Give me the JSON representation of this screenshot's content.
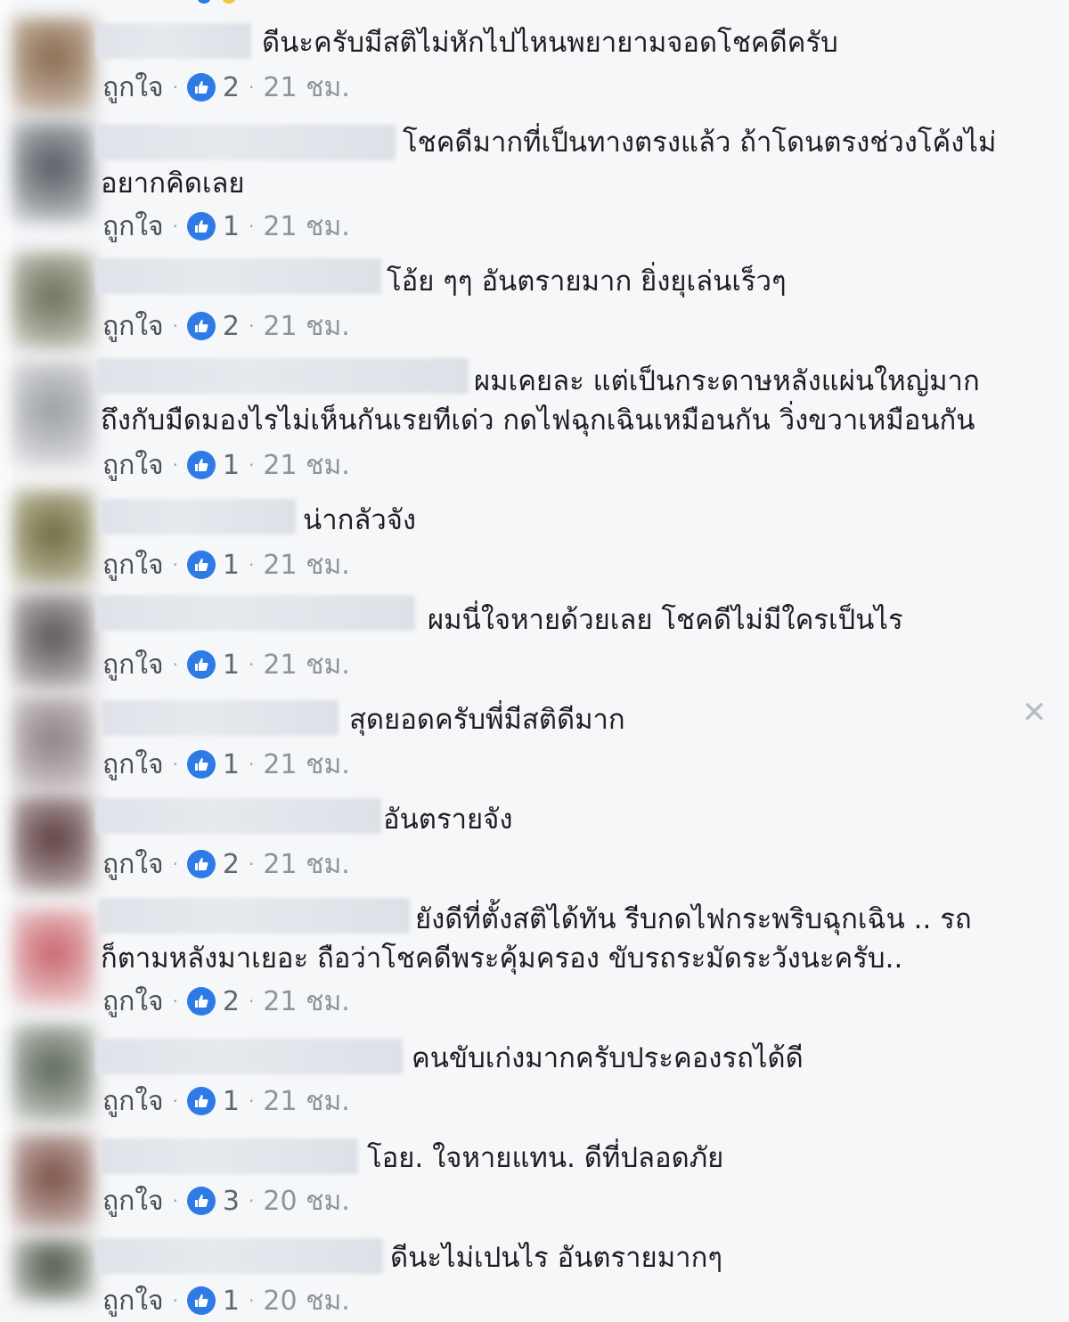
{
  "like_label": "ถูกใจ",
  "time_unit": "ชม.",
  "close_icon": "close-icon",
  "accent_color": "#2f7be6",
  "comments": [
    {
      "text": "ดีนะครับมีสติไม่หักไปไหนพยายามจอดโชคดีครับ",
      "text2": "",
      "likes": "2",
      "time": "21"
    },
    {
      "text": "โชคดีมากที่เป็นทางตรงแล้ว ถ้าโดนตรงช่วงโค้งไม่",
      "text2": "อยากคิดเลย",
      "likes": "1",
      "time": "21"
    },
    {
      "text": "โอ้ย ๆๆ อันตรายมาก ยิ่งยุเล่นเร็วๆ",
      "text2": "",
      "likes": "2",
      "time": "21"
    },
    {
      "text": "ผมเคยละ แต่เป็นกระดาษหลังแผ่นใหญ่มาก",
      "text2": "ถึงกับมืดมองไรไม่เห็นกันเรยทีเด่ว กดไฟฉุกเฉินเหมือนกัน วิ่งขวาเหมือนกัน",
      "likes": "1",
      "time": "21"
    },
    {
      "text": "น่ากลัวจัง",
      "text2": "",
      "likes": "1",
      "time": "21"
    },
    {
      "text": "ผมนี่ใจหายด้วยเลย โชคดีไม่มีใครเป็นไร",
      "text2": "",
      "likes": "1",
      "time": "21"
    },
    {
      "text": "สุดยอดครับพี่มีสติดีมาก",
      "text2": "",
      "likes": "1",
      "time": "21"
    },
    {
      "text": "อันตรายจัง",
      "text2": "",
      "likes": "2",
      "time": "21"
    },
    {
      "text": "ยังดีที่ตั้งสติได้ทัน รีบกดไฟกระพริบฉุกเฉิน .. รถ",
      "text2": "ก็ตามหลังมาเยอะ ถือว่าโชคดีพระคุ้มครอง ขับรถระมัดระวังนะครับ..",
      "likes": "2",
      "time": "21"
    },
    {
      "text": "คนขับเก่งมากครับประคองรถได้ดี",
      "text2": "",
      "likes": "1",
      "time": "21"
    },
    {
      "text": "โอย. ใจหายแทน. ดีที่ปลอดภัย",
      "text2": "",
      "likes": "3",
      "time": "20"
    },
    {
      "text": "ดีนะไม่เปนไร อันตรายมากๆ",
      "text2": "",
      "likes": "1",
      "time": "20"
    }
  ]
}
